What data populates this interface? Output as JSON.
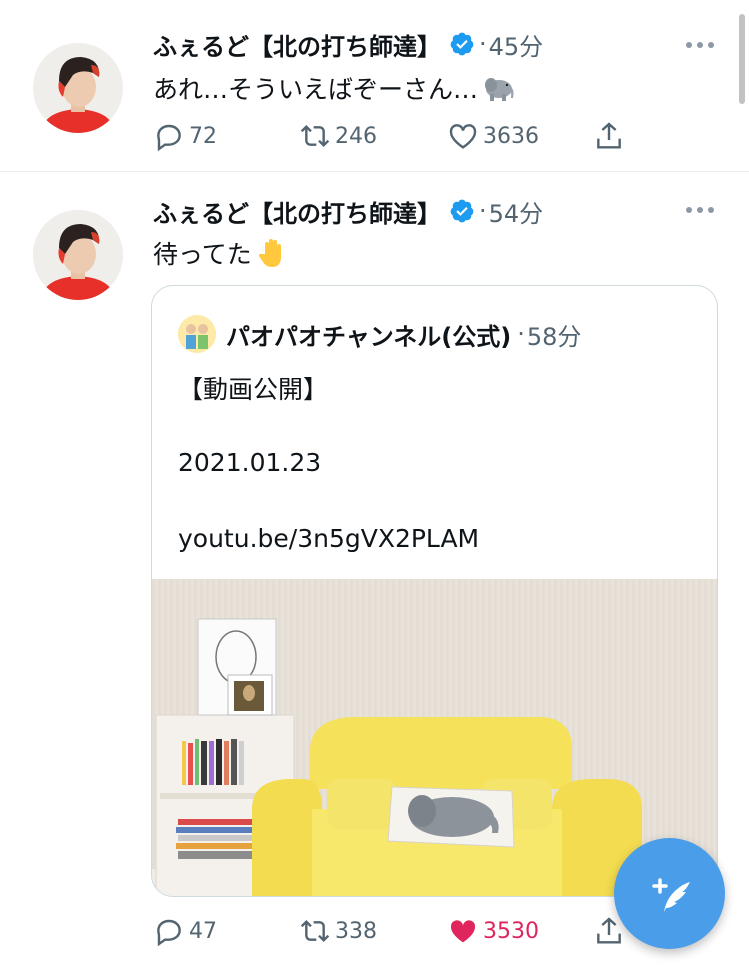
{
  "tweets": [
    {
      "author": "ふぇるど【北の打ち師達】",
      "time": "45分",
      "text": "あれ…そういえばぞーさん…",
      "emoji": "elephant-emoji",
      "replies": "72",
      "retweets": "246",
      "likes": "3636",
      "liked": false
    },
    {
      "author": "ふぇるど【北の打ち師達】",
      "time": "54分",
      "text": "待ってた",
      "emoji": "raised-hand-emoji",
      "replies": "47",
      "retweets": "338",
      "likes": "3530",
      "liked": true,
      "quote": {
        "author": "パオパオチャンネル(公式)",
        "time": "58分",
        "lines": [
          "【動画公開】",
          "2021.01.23",
          "youtu.be/3n5gVX2PLAM"
        ],
        "media": "room-with-yellow-sofa-photo"
      }
    }
  ],
  "separator": "·",
  "colors": {
    "accent": "#1d9bf0",
    "like": "#e0245e",
    "muted": "#536471",
    "fab": "#4a9de8"
  },
  "icons": [
    "verified-icon",
    "more-icon",
    "reply-icon",
    "retweet-icon",
    "like-icon",
    "share-icon",
    "compose-tweet-icon"
  ]
}
